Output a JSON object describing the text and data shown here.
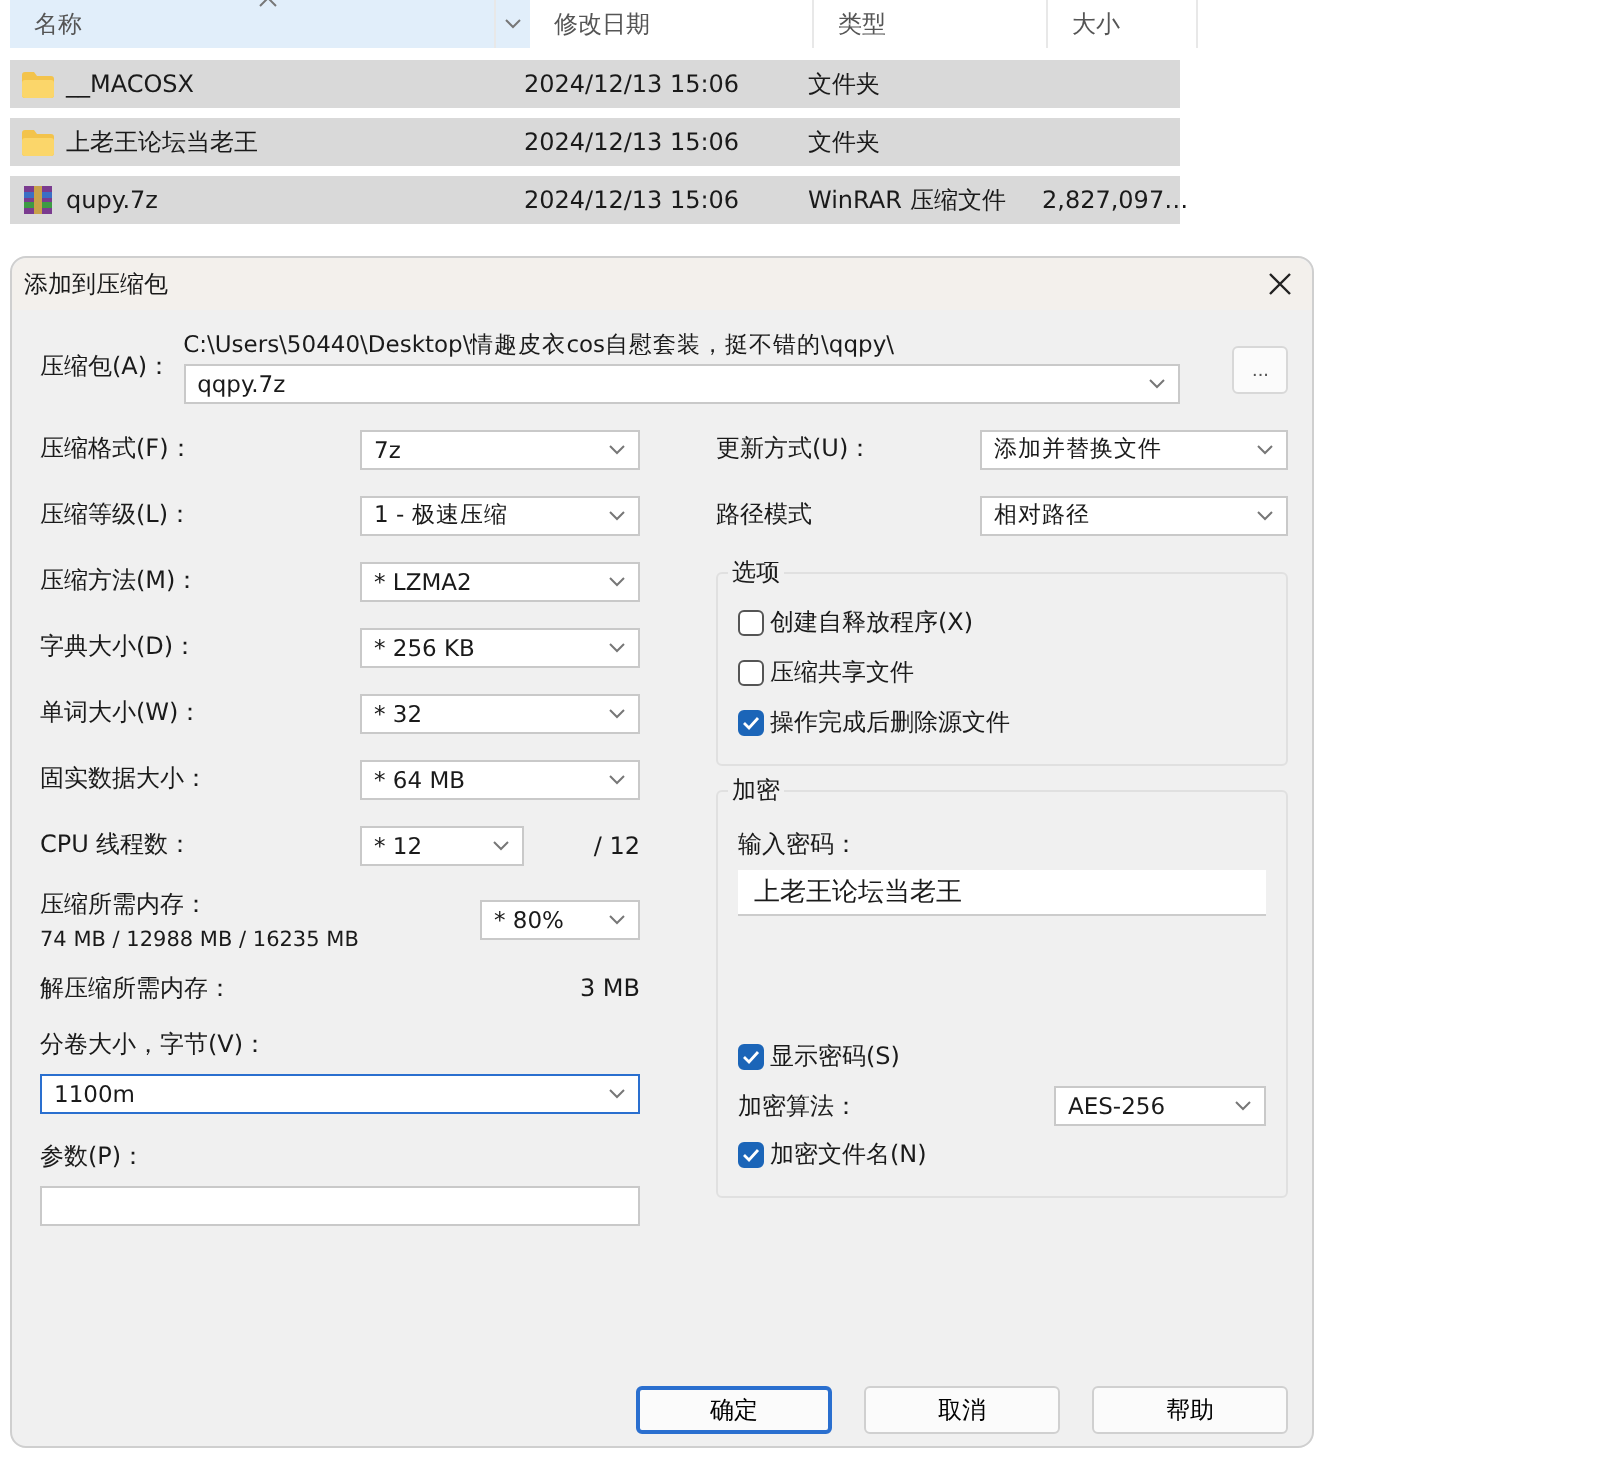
{
  "explorer": {
    "columns": [
      {
        "label": "名称",
        "sorted": true
      },
      {
        "label": "修改日期",
        "sorted": false
      },
      {
        "label": "类型",
        "sorted": false
      },
      {
        "label": "大小",
        "sorted": false
      }
    ],
    "rows": [
      {
        "kind": "folder",
        "name": "__MACOSX",
        "modified": "2024/12/13 15:06",
        "type": "文件夹",
        "selected": true
      },
      {
        "kind": "folder",
        "name": "上老王论坛当老王",
        "modified": "2024/12/13 15:06",
        "type": "文件夹",
        "selected": true
      },
      {
        "kind": "archive",
        "name": "qupy.7z",
        "modified": "2024/12/13 15:06",
        "type": "WinRAR 压缩文件",
        "size": "2,827,097…",
        "selected": true
      }
    ]
  },
  "dialog": {
    "title": "添加到压缩包",
    "archive": {
      "label": "压缩包(A)：",
      "path": "C:\\Users\\50440\\Desktop\\情趣皮衣cos自慰套装，挺不错的\\qqpy\\",
      "value": "qqpy.7z",
      "browse": "..."
    },
    "left": [
      {
        "kind": "select",
        "label": "压缩格式(F)：",
        "value": "7z"
      },
      {
        "kind": "select",
        "label": "压缩等级(L)：",
        "value": "1 - 极速压缩"
      },
      {
        "kind": "select",
        "label": "压缩方法(M)：",
        "value": "* LZMA2"
      },
      {
        "kind": "select",
        "label": "字典大小(D)：",
        "value": "* 256 KB"
      },
      {
        "kind": "select",
        "label": "单词大小(W)：",
        "value": "* 32"
      },
      {
        "kind": "select",
        "label": "固实数据大小：",
        "value": "* 64 MB"
      },
      {
        "kind": "threads",
        "label": "CPU 线程数：",
        "value": "* 12",
        "suffix": "/ 12"
      },
      {
        "kind": "memory",
        "label": "压缩所需内存：",
        "detail": "74 MB / 12988 MB / 16235 MB",
        "value": "* 80%"
      },
      {
        "kind": "info",
        "label": "解压缩所需内存：",
        "value": "3 MB"
      },
      {
        "kind": "combo",
        "label": "分卷大小，字节(V)：",
        "value": "1100m",
        "focused": true
      },
      {
        "kind": "text",
        "label": "参数(P)："
      }
    ],
    "update": {
      "label": "更新方式(U)：",
      "value": "添加并替换文件"
    },
    "path_mode": {
      "label": "路径模式",
      "value": "相对路径"
    },
    "options": {
      "title": "选项",
      "items": [
        {
          "label": "创建自释放程序(X)",
          "checked": false
        },
        {
          "label": "压缩共享文件",
          "checked": false
        },
        {
          "label": "操作完成后删除源文件",
          "checked": true
        }
      ]
    },
    "encryption": {
      "title": "加密",
      "password_label": "输入密码：",
      "password": "上老王论坛当老王",
      "show_password": {
        "label": "显示密码(S)",
        "checked": true
      },
      "method": {
        "label": "加密算法：",
        "value": "AES-256"
      },
      "encrypt_names": {
        "label": "加密文件名(N)",
        "checked": true
      }
    },
    "buttons": [
      {
        "label": "确定",
        "default": true
      },
      {
        "label": "取消",
        "default": false
      },
      {
        "label": "帮助",
        "default": false
      }
    ]
  }
}
